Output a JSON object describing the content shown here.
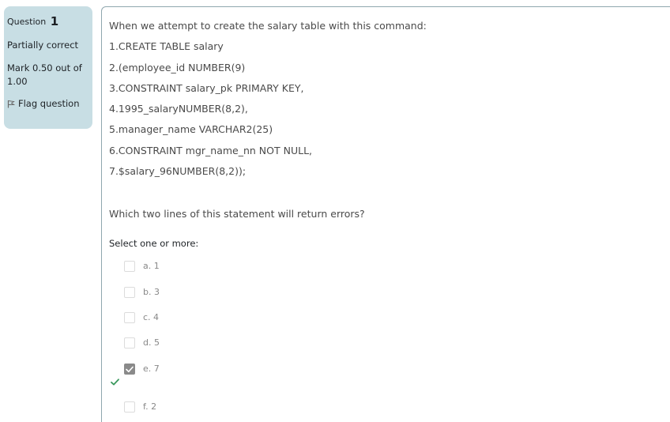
{
  "info": {
    "question_label": "Question",
    "question_number": "1",
    "state": "Partially correct",
    "grade": "Mark 0.50 out of 1.00",
    "flag_label": "Flag question"
  },
  "question": {
    "intro": "When we attempt to create the salary table with this command:",
    "lines": [
      "1.CREATE TABLE salary",
      "2.(employee_id NUMBER(9)",
      "3.CONSTRAINT salary_pk PRIMARY KEY,",
      "4.1995_salaryNUMBER(8,2),",
      "5.manager_name VARCHAR2(25)",
      "6.CONSTRAINT mgr_name_nn NOT NULL,",
      "7.$salary_96NUMBER(8,2));"
    ],
    "prompt": "Which two lines of this statement will return errors?",
    "select_label": "Select one or more:"
  },
  "options": [
    {
      "label": "a. 1",
      "checked": false
    },
    {
      "label": "b. 3",
      "checked": false
    },
    {
      "label": "c. 4",
      "checked": false
    },
    {
      "label": "d. 5",
      "checked": false
    },
    {
      "label": "e. 7",
      "checked": true
    },
    {
      "label": "f. 2",
      "checked": false
    }
  ],
  "colors": {
    "info_panel_bg": "#c8dee4",
    "border": "#8fa7ae",
    "correct_green": "#3c9a5f",
    "checked_box": "#8a8a8a"
  },
  "icons": {
    "flag": "flag-icon",
    "correct": "check-icon"
  }
}
